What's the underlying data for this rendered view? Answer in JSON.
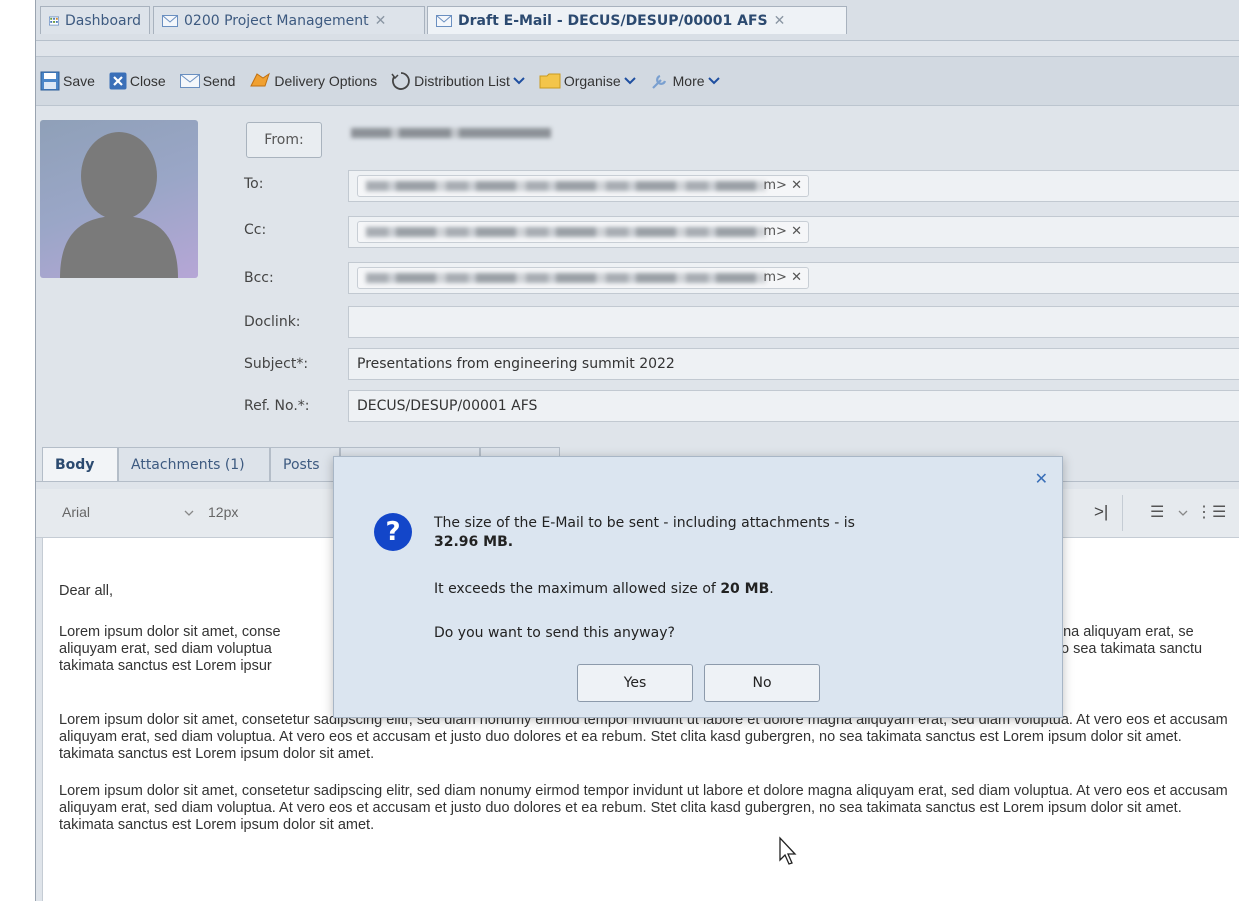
{
  "tabs": [
    {
      "label": "Dashboard",
      "closable": false
    },
    {
      "label": "0200 Project Management",
      "closable": true
    },
    {
      "label": "Draft E-Mail - DECUS/DESUP/00001 AFS",
      "closable": true
    }
  ],
  "tab_close_glyph": "✕",
  "toolbar": {
    "save": "Save",
    "close": "Close",
    "send": "Send",
    "delivery_options": "Delivery Options",
    "distribution_list": "Distribution List",
    "organise": "Organise",
    "more": "More"
  },
  "header": {
    "from_button": "From:",
    "to_label": "To:",
    "cc_label": "Cc:",
    "bcc_label": "Bcc:",
    "doclink_label": "Doclink:",
    "subject_label": "Subject*:",
    "refno_label": "Ref. No.*:",
    "recipient_tail": "m>",
    "chip_remove": "✕",
    "doclink_value": "",
    "subject_value": "Presentations from engineering summit 2022",
    "refno_value": "DECUS/DESUP/00001 AFS"
  },
  "body_tabs": [
    "Body",
    "Attachments (1)",
    "Posts"
  ],
  "editor_toolbar": {
    "font_family": "Arial",
    "font_size": "12px",
    "glyph_indent": ">|",
    "glyph_bullets": "☰",
    "glyph_numbers": "⋮☰"
  },
  "editor": {
    "greeting": "Dear all,",
    "para1_line1_left": "Lorem ipsum dolor sit amet, conse",
    "para1_line1_right": "gna aliquyam erat, se",
    "para1_line2_left": "aliquyam erat, sed diam voluptua",
    "para1_line2_right": "o sea takimata sanctu",
    "para1_line3_left": "takimata sanctus est Lorem ipsur",
    "para2_line1": "Lorem ipsum dolor sit amet, consetetur sadipscing elitr, sed diam nonumy eirmod tempor invidunt ut labore et dolore magna aliquyam erat, sed diam voluptua. At vero eos et accusam",
    "para2_line2": "aliquyam erat, sed diam voluptua. At vero eos et accusam et justo duo dolores et ea rebum. Stet clita kasd gubergren, no sea takimata sanctus est Lorem ipsum dolor sit amet.",
    "para2_line3": "takimata sanctus est Lorem ipsum dolor sit amet.",
    "para3_line1": "Lorem ipsum dolor sit amet, consetetur sadipscing elitr, sed diam nonumy eirmod tempor invidunt ut labore et dolore magna aliquyam erat, sed diam voluptua. At vero eos et accusam",
    "para3_line2": "aliquyam erat, sed diam voluptua. At vero eos et accusam et justo duo dolores et ea rebum. Stet clita kasd gubergren, no sea takimata sanctus est Lorem ipsum dolor sit amet.",
    "para3_line3": "takimata sanctus est Lorem ipsum dolor sit amet."
  },
  "dialog": {
    "close": "✕",
    "icon": "?",
    "line1": "The size of the E-Mail to be sent - including attachments - is",
    "size_value": "32.96 MB",
    "line2_prefix": "It exceeds the maximum allowed size of ",
    "max_value": "20 MB",
    "period": ".",
    "question": "Do you want to send this anyway?",
    "yes": "Yes",
    "no": "No"
  },
  "colors": {
    "accent": "#1346c9",
    "tab_text": "#3d5a80"
  }
}
